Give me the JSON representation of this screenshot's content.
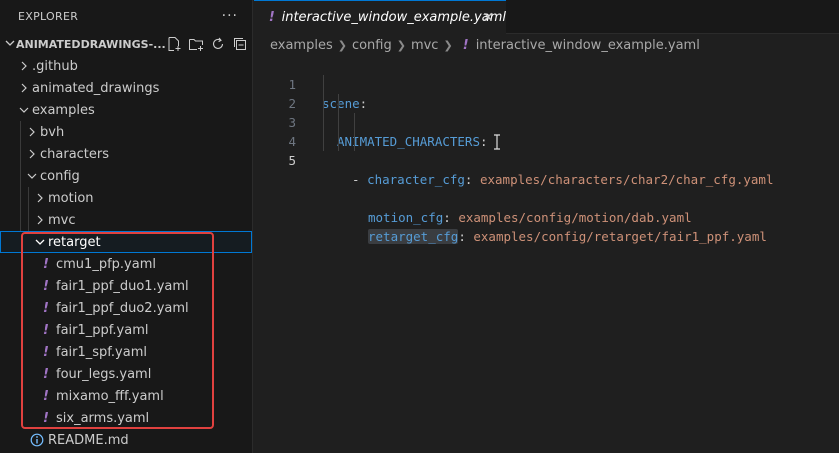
{
  "explorer": {
    "title": "EXPLORER",
    "more_icon": "ellipsis-icon",
    "workspace": "ANIMATEDDRAWINGS-...",
    "workspace_actions": [
      "new-file-icon",
      "new-folder-icon",
      "refresh-icon",
      "collapse-all-icon"
    ],
    "tree": {
      "github": ".github",
      "animated_drawings": "animated_drawings",
      "examples": "examples",
      "bvh": "bvh",
      "characters": "characters",
      "config": "config",
      "motion": "motion",
      "mvc": "mvc",
      "retarget": "retarget",
      "files": [
        "cmu1_pfp.yaml",
        "fair1_ppf_duo1.yaml",
        "fair1_ppf_duo2.yaml",
        "fair1_ppf.yaml",
        "fair1_spf.yaml",
        "four_legs.yaml",
        "mixamo_fff.yaml",
        "six_arms.yaml"
      ],
      "readme": "README.md"
    }
  },
  "tab": {
    "label": "interactive_window_example.yaml",
    "icon": "!",
    "close": "✕"
  },
  "breadcrumb": [
    "examples",
    "config",
    "mvc",
    "interactive_window_example.yaml"
  ],
  "editor": {
    "line_numbers": [
      "1",
      "2",
      "3",
      "4",
      "5"
    ],
    "line1": {
      "key": "scene",
      "colon": ":"
    },
    "line2": {
      "key": "ANIMATED_CHARACTERS",
      "colon": ":"
    },
    "line3": {
      "dash": "- ",
      "key": "character_cfg",
      "colon": ": ",
      "value": "examples/characters/char2/char_cfg.yaml"
    },
    "line4": {
      "key": "motion_cfg",
      "colon": ": ",
      "value": "examples/config/motion/dab.yaml"
    },
    "line5": {
      "key": "retarget_cfg",
      "colon": ": ",
      "value": "examples/config/retarget/fair1_ppf.yaml"
    }
  },
  "colors": {
    "accent": "#0078d4",
    "highlight_box": "#e0413f",
    "yaml_icon": "#a074c4",
    "key": "#569cd6",
    "string": "#ce9178"
  }
}
